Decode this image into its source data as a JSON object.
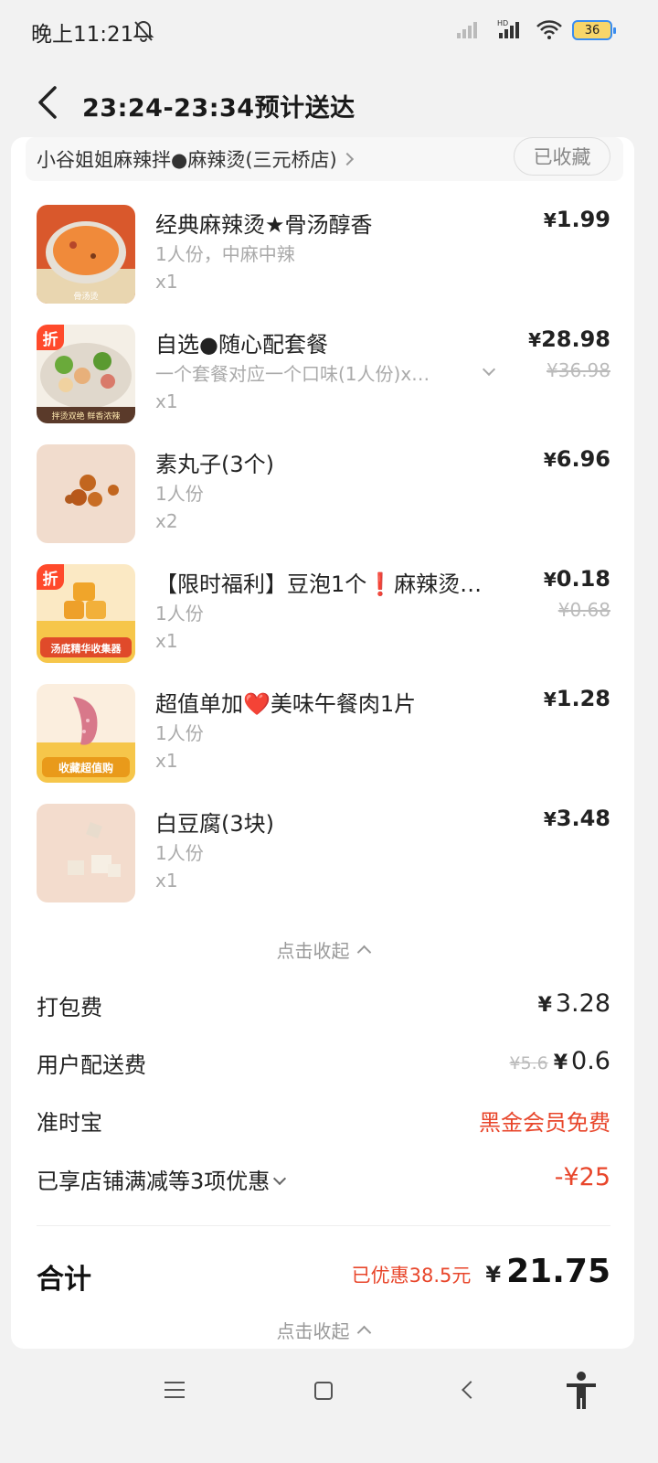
{
  "status_bar": {
    "time": "晚上11:21",
    "battery": "36"
  },
  "header": {
    "title": "23:24-23:34预计送达"
  },
  "shop": {
    "name": "小谷姐姐麻辣拌●麻辣烫(三元桥店)",
    "favorite_label": "已收藏"
  },
  "items": [
    {
      "name": "经典麻辣烫★骨汤醇香",
      "spec": "1人份，中麻中辣",
      "qty": "x1",
      "price": "1.99",
      "orig": "",
      "discount": false
    },
    {
      "name": "自选●随心配套餐",
      "spec": "一个套餐对应一个口味(1人份)x…",
      "qty": "x1",
      "price": "28.98",
      "orig": "¥36.98",
      "discount": true
    },
    {
      "name": "素丸子(3个)",
      "spec": "1人份",
      "qty": "x2",
      "price": "6.96",
      "orig": "",
      "discount": false
    },
    {
      "name": "【限时福利】豆泡1个❗麻辣烫…",
      "spec": "1人份",
      "qty": "x1",
      "price": "0.18",
      "orig": "¥0.68",
      "discount": true
    },
    {
      "name": "超值单加❤️美味午餐肉1片",
      "spec": "1人份",
      "qty": "x1",
      "price": "1.28",
      "orig": "",
      "discount": false
    },
    {
      "name": "白豆腐(3块)",
      "spec": "1人份",
      "qty": "x1",
      "price": "3.48",
      "orig": "",
      "discount": false
    }
  ],
  "discount_badge": "折",
  "currency": "¥",
  "thumb_labels": {
    "item1": "骨汤烫",
    "item2": "拌烫双绝 鲜香浓辣",
    "item4": "汤底精华收集器",
    "item5": "收藏超值购"
  },
  "collapse_label": "点击收起",
  "fees": {
    "packing_label": "打包费",
    "packing_value": "3.28",
    "delivery_label": "用户配送费",
    "delivery_orig": "¥5.6",
    "delivery_value": "0.6",
    "ontime_label": "准时宝",
    "ontime_value": "黑金会员免费",
    "promo_label": "已享店铺满减等3项优惠",
    "promo_value": "-¥25"
  },
  "total": {
    "label": "合计",
    "saved": "已优惠38.5元",
    "value": "21.75"
  },
  "colors": {
    "accent_red": "#e8462b",
    "badge_red": "#ff4a2b"
  }
}
